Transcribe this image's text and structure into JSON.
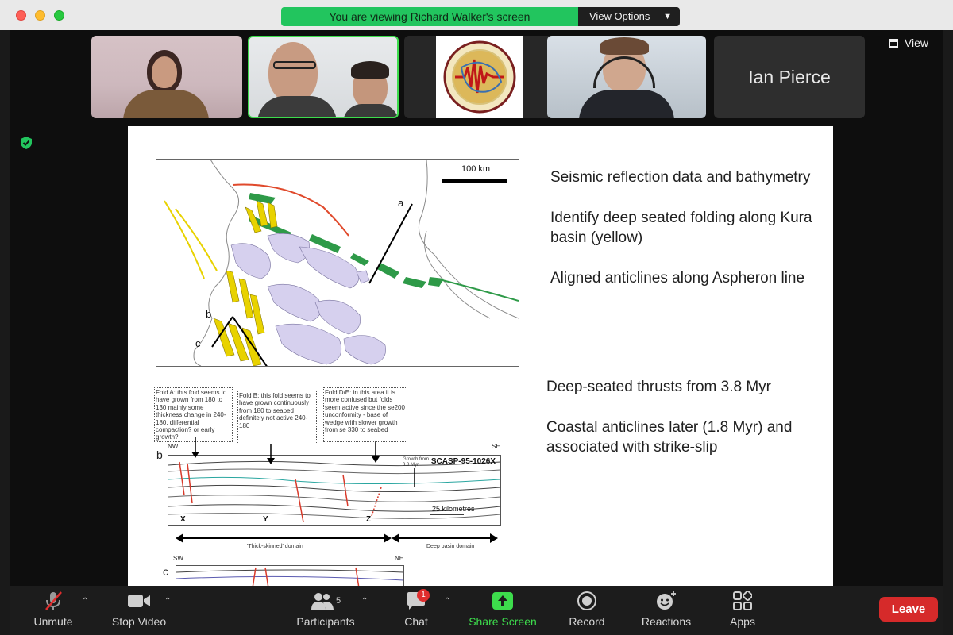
{
  "banner": {
    "text": "You are viewing Richard Walker's screen",
    "view_options": "View Options"
  },
  "gallery": {
    "view_label": "View",
    "participant_name": "Ian Pierce"
  },
  "slide": {
    "bullets_top": [
      "Seismic reflection data and bathymetry",
      "Identify deep seated folding along Kura basin (yellow)",
      "Aligned anticlines along Aspheron line"
    ],
    "bullets_bottom": [
      "Deep-seated thrusts from 3.8 Myr",
      "Coastal anticlines later (1.8 Myr) and associated with strike-slip"
    ],
    "map_scale": "100 km",
    "label_a": "a",
    "label_b": "b",
    "label_c": "c",
    "callouts": [
      "Fold A: this fold seems to have grown from 180 to 130 mainly some thickness change in 240-180, differential compaction? or early growth?",
      "Fold B: this fold seems to have grown continuously from 180 to seabed definitely not active 240-180",
      "Fold D/E: in this area it is more confused but folds seem active since the se200 unconformity - base of wedge with slower growth from se 330 to seabed"
    ],
    "section_b_label": "b",
    "section_c_label": "c",
    "nw": "NW",
    "se": "SE",
    "sw": "SW",
    "ne": "NE",
    "seismic_id": "SCASP-95-1026X",
    "growth_note": "Growth from 3.8 Myr",
    "fold_x": "X",
    "fold_y": "Y",
    "fold_z": "Z",
    "scale_text": "25 kilometres",
    "domain_thick": "'Thick-skinned' domain",
    "domain_basin": "Deep basin domain"
  },
  "toolbar": {
    "unmute": "Unmute",
    "stop_video": "Stop Video",
    "participants": "Participants",
    "participant_count": "5",
    "chat": "Chat",
    "chat_badge": "1",
    "share": "Share Screen",
    "record": "Record",
    "reactions": "Reactions",
    "apps": "Apps",
    "leave": "Leave"
  },
  "colors": {
    "share_green": "#3ddc4c",
    "leave_red": "#d62a2a",
    "banner_green": "#22c55e"
  }
}
